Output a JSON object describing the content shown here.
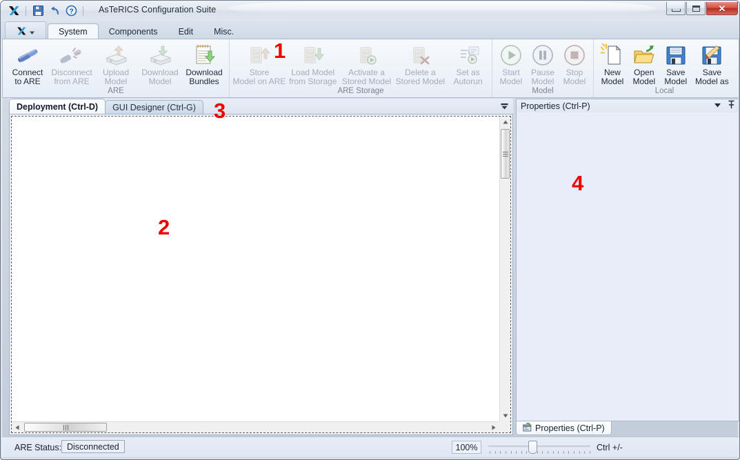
{
  "window": {
    "title": "AsTeRICS Configuration Suite",
    "quick_access": [
      {
        "name": "app-logo-icon",
        "label": "AsTeRICS"
      },
      {
        "name": "save-icon",
        "label": "Save"
      },
      {
        "name": "undo-icon",
        "label": "Undo"
      },
      {
        "name": "help-icon",
        "label": "Help"
      }
    ],
    "controls": {
      "minimize": "Minimize",
      "maximize": "Maximize",
      "close": "✕"
    }
  },
  "ribbon": {
    "app_button_label": "",
    "tabs": [
      {
        "label": "System",
        "active": true
      },
      {
        "label": "Components",
        "active": false
      },
      {
        "label": "Edit",
        "active": false
      },
      {
        "label": "Misc.",
        "active": false
      }
    ],
    "groups": [
      {
        "label": "ARE",
        "items": [
          {
            "label": "Connect\nto ARE",
            "icon": "connect-plug-icon",
            "disabled": false
          },
          {
            "label": "Disconnect\nfrom ARE",
            "icon": "disconnect-plug-icon",
            "disabled": true
          },
          {
            "label": "Upload\nModel",
            "icon": "upload-drive-icon",
            "disabled": true
          },
          {
            "label": "Download\nModel",
            "icon": "download-drive-icon",
            "disabled": true
          },
          {
            "label": "Download\nBundles",
            "icon": "download-bundles-icon",
            "disabled": false
          }
        ]
      },
      {
        "label": "ARE Storage",
        "items": [
          {
            "label": "Store\nModel on ARE",
            "icon": "store-model-icon",
            "disabled": true
          },
          {
            "label": "Load Model\nfrom Storage",
            "icon": "load-model-icon",
            "disabled": true
          },
          {
            "label": "Activate a\nStored Model",
            "icon": "activate-model-icon",
            "disabled": true
          },
          {
            "label": "Delete a\nStored Model",
            "icon": "delete-model-icon",
            "disabled": true
          },
          {
            "label": "Set as\nAutorun",
            "icon": "set-autorun-icon",
            "disabled": true
          }
        ]
      },
      {
        "label": "Model",
        "items": [
          {
            "label": "Start\nModel",
            "icon": "play-icon",
            "disabled": true
          },
          {
            "label": "Pause\nModel",
            "icon": "pause-icon",
            "disabled": true
          },
          {
            "label": "Stop\nModel",
            "icon": "stop-icon",
            "disabled": true
          }
        ]
      },
      {
        "label": "Local",
        "items": [
          {
            "label": "New\nModel",
            "icon": "new-document-icon",
            "disabled": false
          },
          {
            "label": "Open\nModel",
            "icon": "open-folder-icon",
            "disabled": false
          },
          {
            "label": "Save\nModel",
            "icon": "floppy-save-icon",
            "disabled": false
          },
          {
            "label": "Save\nModel as",
            "icon": "floppy-save-as-icon",
            "disabled": false
          }
        ]
      }
    ]
  },
  "editor": {
    "tabs": [
      {
        "label": "Deployment (Ctrl-D)",
        "active": true
      },
      {
        "label": "GUI Designer (Ctrl-G)",
        "active": false
      }
    ],
    "dropdown_icon": "chevron-down-icon",
    "canvas_content": ""
  },
  "properties": {
    "header_title": "Properties (Ctrl-P)",
    "header_icons": [
      {
        "name": "chevron-down-icon"
      },
      {
        "name": "pin-icon"
      }
    ],
    "bottom_tab_label": "Properties (Ctrl-P)",
    "bottom_tab_icon": "properties-window-icon"
  },
  "statusbar": {
    "are_status_label": "ARE Status:",
    "are_status_value": "Disconnected",
    "zoom_percent": "100%",
    "zoom_hint": "Ctrl +/-"
  },
  "annotations": [
    {
      "id": "1",
      "text": "1",
      "target": "ARE Storage ribbon group"
    },
    {
      "id": "2",
      "text": "2",
      "target": "Deployment canvas"
    },
    {
      "id": "3",
      "text": "3",
      "target": "Editor tab bar"
    },
    {
      "id": "4",
      "text": "4",
      "target": "Properties panel"
    }
  ],
  "colors": {
    "annotation_red": "#f00000",
    "accent_blue": "#2f7fc4",
    "title_text": "#1d2a38",
    "disabled_text": "#a5acb6"
  }
}
